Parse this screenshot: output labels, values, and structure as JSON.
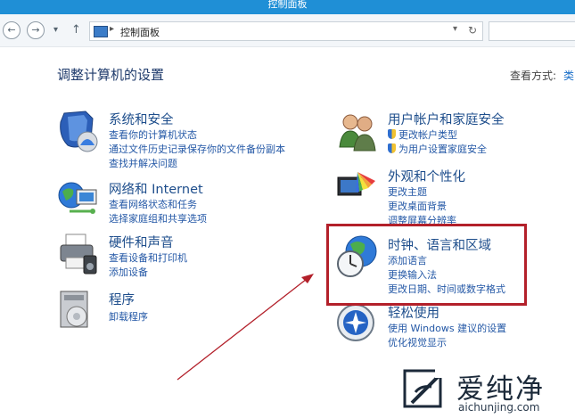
{
  "window": {
    "title": "控制面板"
  },
  "address_bar": {
    "path": "控制面板",
    "refresh_glyph": "↻"
  },
  "page": {
    "title": "调整计算机的设置"
  },
  "view_by": {
    "label": "查看方式:",
    "value": "类"
  },
  "categories": [
    {
      "title": "系统和安全",
      "links": [
        "查看你的计算机状态",
        "通过文件历史记录保存你的文件备份副本",
        "查找并解决问题"
      ],
      "icon": "shield-security-icon"
    },
    {
      "title": "网络和 Internet",
      "links": [
        "查看网络状态和任务",
        "选择家庭组和共享选项"
      ],
      "icon": "network-globe-icon"
    },
    {
      "title": "硬件和声音",
      "links": [
        "查看设备和打印机",
        "添加设备"
      ],
      "icon": "printer-icon"
    },
    {
      "title": "程序",
      "links": [
        "卸载程序"
      ],
      "icon": "programs-icon"
    },
    {
      "title": "用户帐户和家庭安全",
      "links": [
        "更改帐户类型",
        "为用户设置家庭安全"
      ],
      "icon": "users-icon"
    },
    {
      "title": "外观和个性化",
      "links": [
        "更改主题",
        "更改桌面背景",
        "调整屏幕分辨率"
      ],
      "icon": "appearance-icon"
    },
    {
      "title": "时钟、语言和区域",
      "links": [
        "添加语言",
        "更换输入法",
        "更改日期、时间或数字格式"
      ],
      "icon": "clock-globe-icon"
    },
    {
      "title": "轻松使用",
      "links": [
        "使用 Windows 建议的设置",
        "优化视觉显示"
      ],
      "icon": "ease-of-access-icon"
    }
  ],
  "watermark": {
    "brand": "爱纯净",
    "url": "aichunjing.com"
  }
}
